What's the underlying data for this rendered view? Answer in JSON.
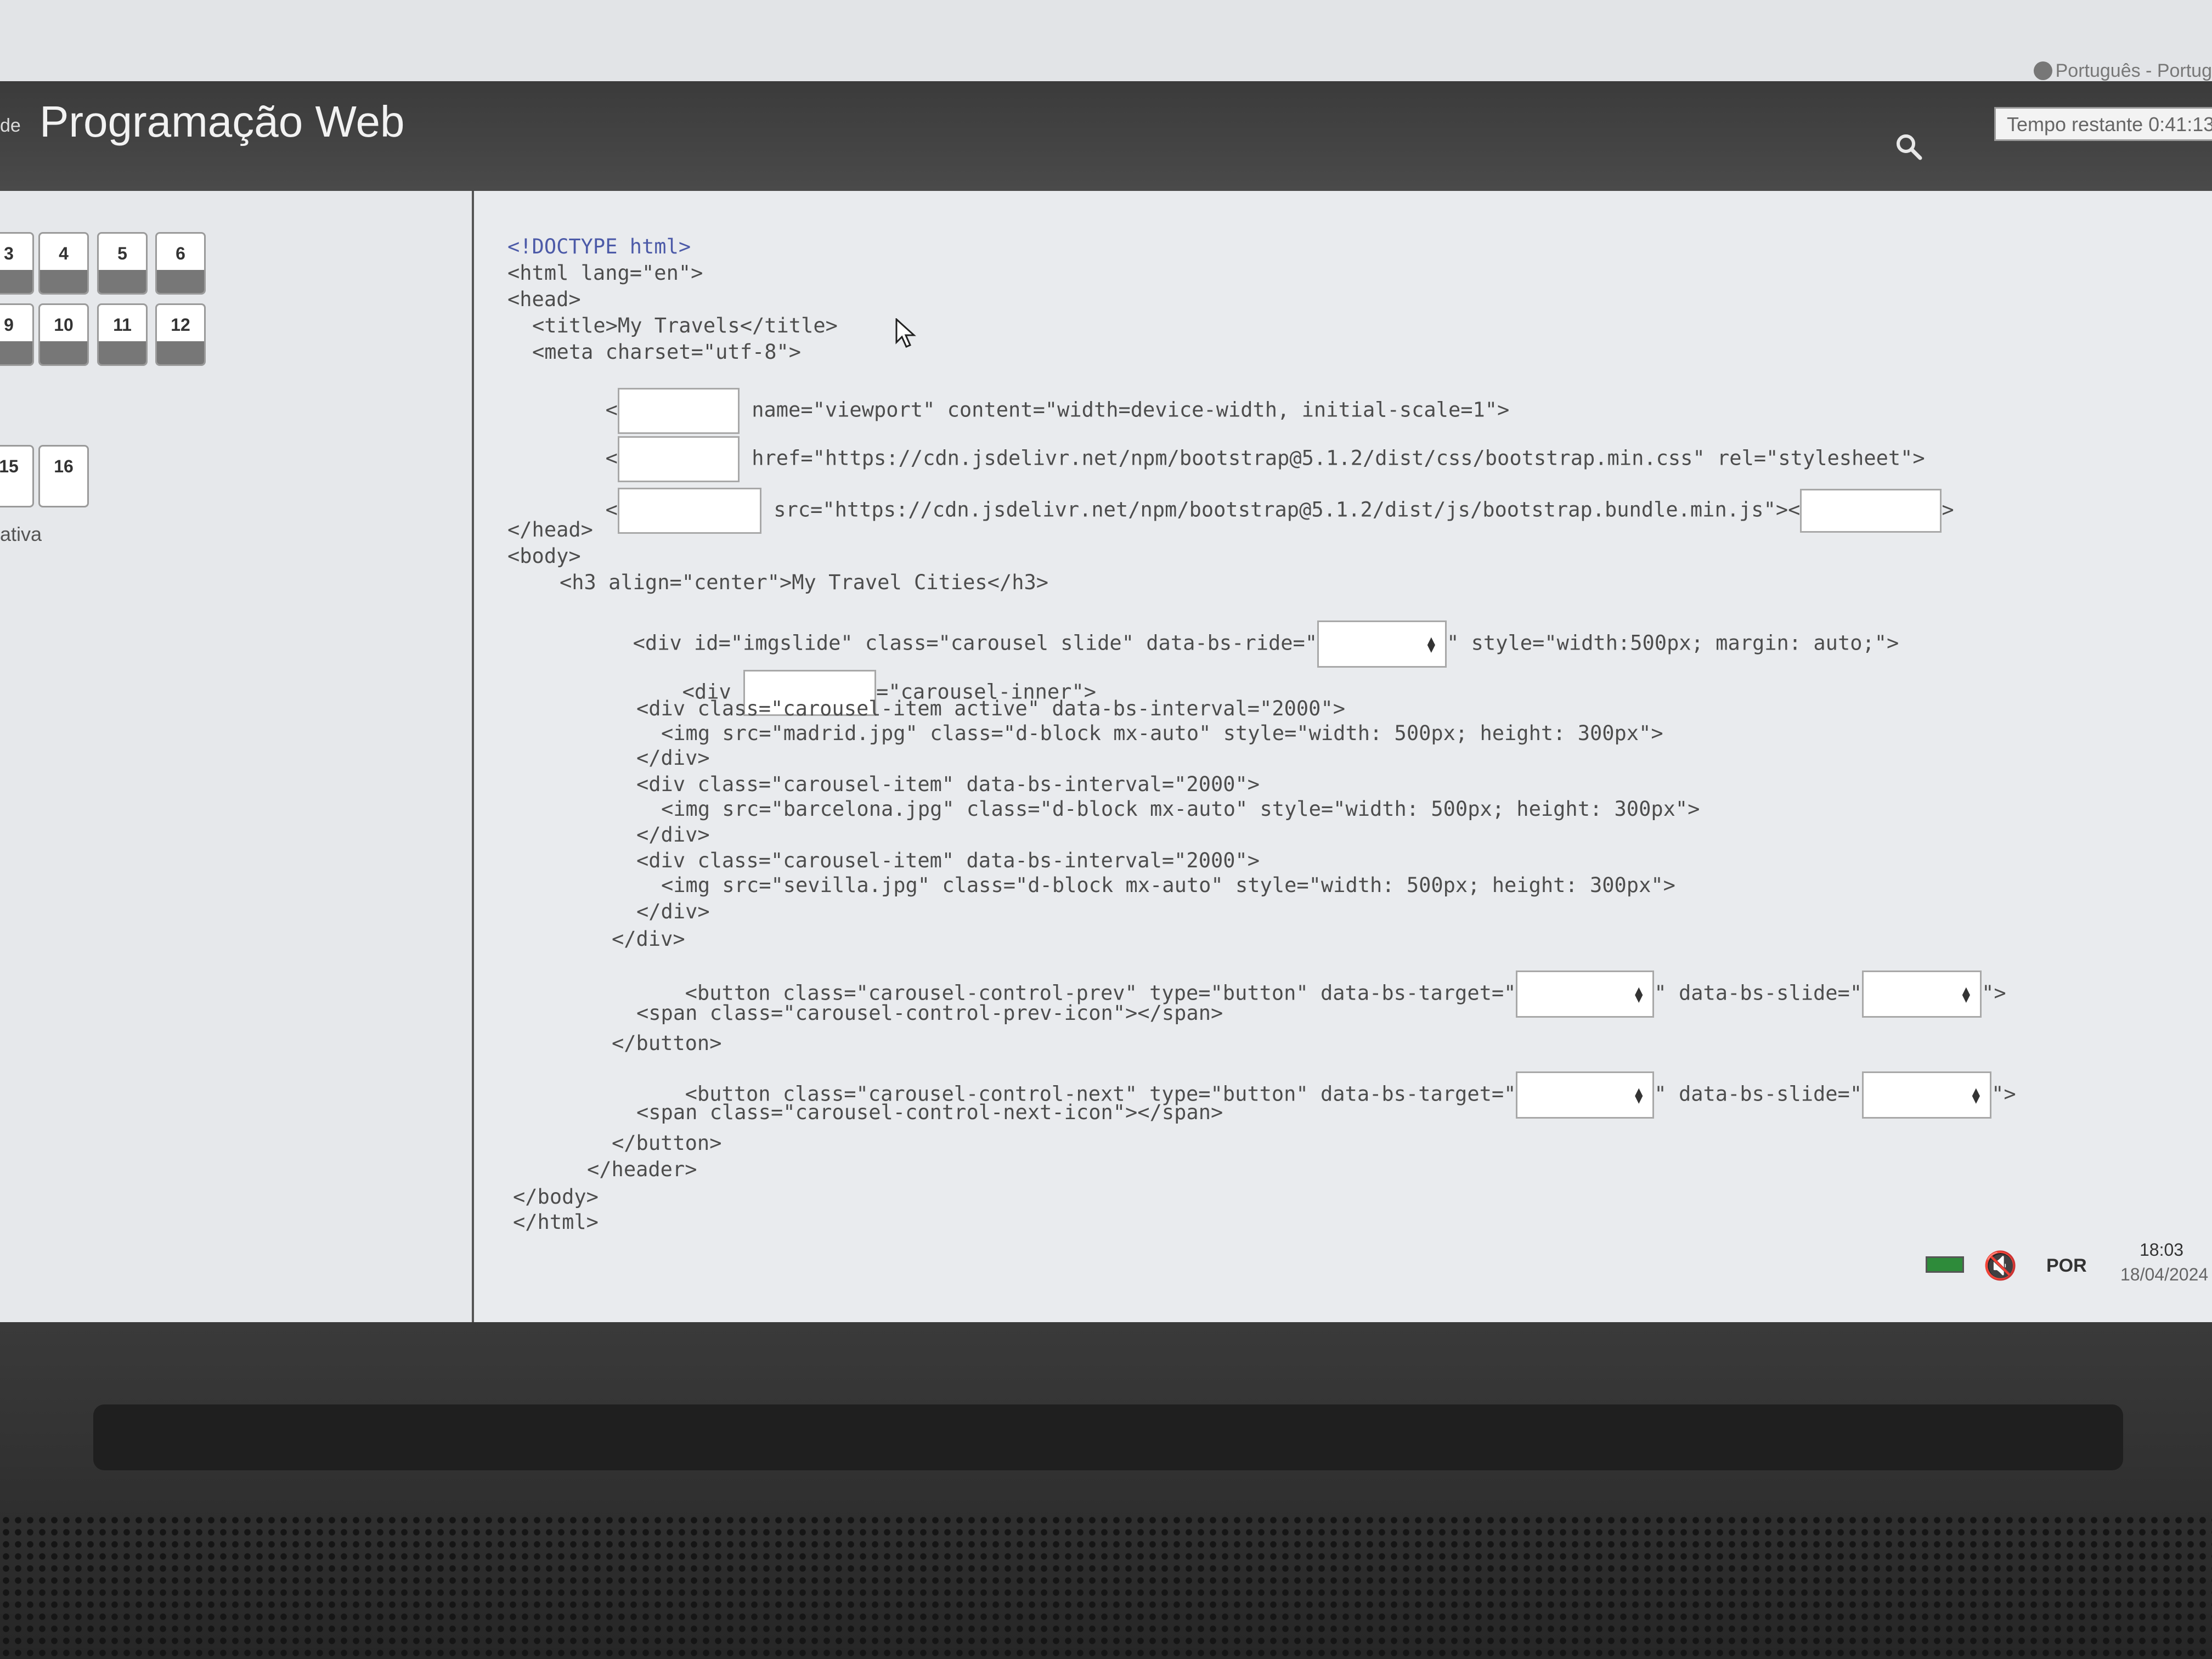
{
  "top_bar": {
    "language": "Português - Portug"
  },
  "header": {
    "prefix": "de",
    "title": "Programação Web"
  },
  "sidebar": {
    "questions": [
      "3",
      "4",
      "5",
      "6",
      "9",
      "10",
      "11",
      "12",
      "15",
      "16"
    ],
    "status": "ativa"
  },
  "timer": "Tempo restante 0:41:13",
  "code": {
    "l1": "<!DOCTYPE html>",
    "l2": "<html lang=\"en\">",
    "l3": "<head>",
    "l4": "<title>My Travels</title>",
    "l5": "<meta charset=\"utf-8\">",
    "l6_lt": "<",
    "l6_rest": "name=\"viewport\" content=\"width=device-width, initial-scale=1\">",
    "l7_lt": "<",
    "l7_rest": "href=\"https://cdn.jsdelivr.net/npm/bootstrap@5.1.2/dist/css/bootstrap.min.css\" rel=\"stylesheet\">",
    "l8_lt": "<",
    "l8_rest": "src=\"https://cdn.jsdelivr.net/npm/bootstrap@5.1.2/dist/js/bootstrap.bundle.min.js\"><",
    "l8_end": ">",
    "l9": "</head>",
    "l10": "<body>",
    "l11": "<h3 align=\"center\">My Travel Cities</h3>",
    "l12_a": "<div id=\"imgslide\" class=\"carousel slide\" data-bs-ride=\"",
    "l12_b": "\" style=\"width:500px; margin: auto;\">",
    "l13_a": "<div",
    "l13_b": "=\"carousel-inner\">",
    "l14": "<div class=\"carousel-item active\" data-bs-interval=\"2000\">",
    "l15": "<img src=\"madrid.jpg\" class=\"d-block mx-auto\" style=\"width: 500px; height: 300px\">",
    "l16": "</div>",
    "l17": "<div class=\"carousel-item\" data-bs-interval=\"2000\">",
    "l18": "<img src=\"barcelona.jpg\" class=\"d-block mx-auto\" style=\"width: 500px; height: 300px\">",
    "l19": "</div>",
    "l20": "<div class=\"carousel-item\" data-bs-interval=\"2000\">",
    "l21": "<img src=\"sevilla.jpg\" class=\"d-block mx-auto\" style=\"width: 500px; height: 300px\">",
    "l22": "</div>",
    "l23": "</div>",
    "l24_a": "<button class=\"carousel-control-prev\" type=\"button\" data-bs-target=\"",
    "l24_b": "\" data-bs-slide=\"",
    "l24_c": "\">",
    "l25": "<span class=\"carousel-control-prev-icon\"></span>",
    "l26": "</button>",
    "l27_a": "<button class=\"carousel-control-next\" type=\"button\" data-bs-target=\"",
    "l27_b": "\" data-bs-slide=\"",
    "l27_c": "\">",
    "l28": "<span class=\"carousel-control-next-icon\"></span>",
    "l29": "</button>",
    "l30": "</header>",
    "l31": "</body>",
    "l32": "</html>"
  },
  "taskbar": {
    "language": "POR",
    "time": "18:03",
    "date": "18/04/2024"
  },
  "colors": {
    "header_bg": "#404040",
    "doctype": "#4c5aa8",
    "code_text": "#4d4d4d",
    "battery": "#2e8b3a"
  }
}
